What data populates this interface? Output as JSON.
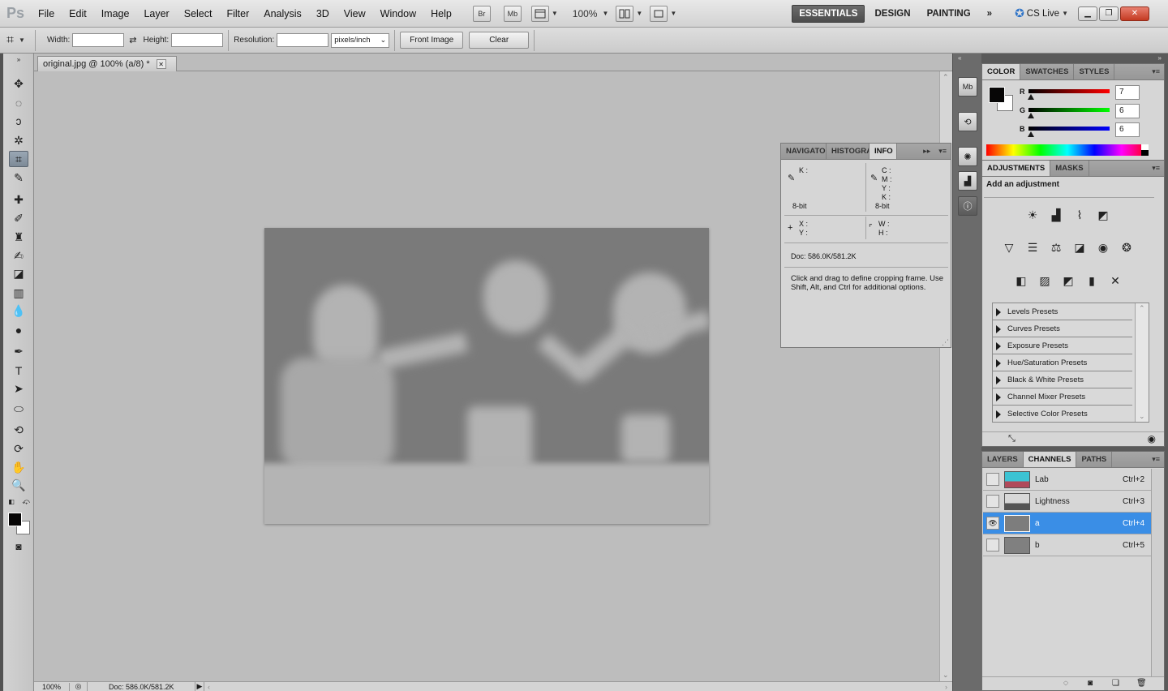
{
  "app": {
    "logo": "Ps"
  },
  "menu": [
    "File",
    "Edit",
    "Image",
    "Layer",
    "Select",
    "Filter",
    "Analysis",
    "3D",
    "View",
    "Window",
    "Help"
  ],
  "appbar": {
    "bridge": "Br",
    "minibridge": "Mb",
    "zoom": "100%"
  },
  "workspaces": {
    "essentials": "ESSENTIALS",
    "design": "DESIGN",
    "painting": "PAINTING",
    "more": "»"
  },
  "cslive": "CS Live",
  "options": {
    "width_label": "Width:",
    "height_label": "Height:",
    "resolution_label": "Resolution:",
    "units": "pixels/inch",
    "front_image": "Front Image",
    "clear": "Clear"
  },
  "document": {
    "tab_title": "original.jpg @ 100% (a/8) *",
    "zoom": "100%",
    "doc_info": "Doc: 586.0K/581.2K"
  },
  "info_panel": {
    "tabs": [
      "NAVIGATO",
      "HISTOGRA",
      "INFO"
    ],
    "k_label": "K :",
    "c_label": "C :",
    "m_label": "M :",
    "y_label": "Y :",
    "k2_label": "K :",
    "bit_left": "8-bit",
    "bit_right": "8-bit",
    "x_label": "X :",
    "y2_label": "Y :",
    "w_label": "W :",
    "h_label": "H :",
    "doc": "Doc: 586.0K/581.2K",
    "hint": "Click and drag to define cropping frame. Use Shift, Alt, and Ctrl for additional options."
  },
  "color_panel": {
    "tabs": [
      "COLOR",
      "SWATCHES",
      "STYLES"
    ],
    "r_label": "R",
    "g_label": "G",
    "b_label": "B",
    "r": "7",
    "g": "6",
    "b": "6",
    "colors": {
      "foreground": "#070606",
      "background": "#ffffff"
    }
  },
  "adjustments_panel": {
    "tabs": [
      "ADJUSTMENTS",
      "MASKS"
    ],
    "heading": "Add an adjustment",
    "presets": [
      "Levels Presets",
      "Curves Presets",
      "Exposure Presets",
      "Hue/Saturation Presets",
      "Black & White Presets",
      "Channel Mixer Presets",
      "Selective Color Presets"
    ]
  },
  "channels_panel": {
    "tabs": [
      "LAYERS",
      "CHANNELS",
      "PATHS"
    ],
    "rows": [
      {
        "name": "Lab",
        "shortcut": "Ctrl+2"
      },
      {
        "name": "Lightness",
        "shortcut": "Ctrl+3"
      },
      {
        "name": "a",
        "shortcut": "Ctrl+4"
      },
      {
        "name": "b",
        "shortcut": "Ctrl+5"
      }
    ],
    "selected_color": "#3a8ee6"
  }
}
